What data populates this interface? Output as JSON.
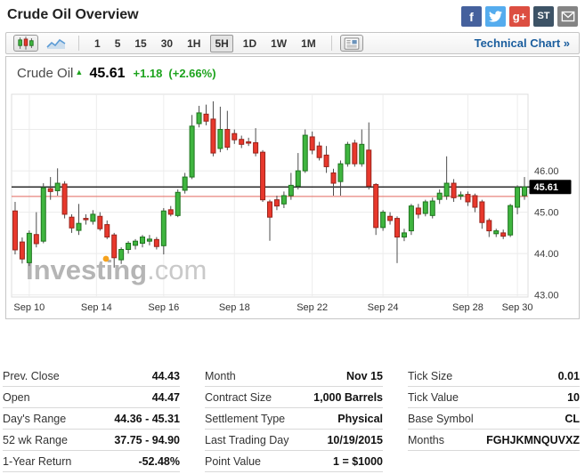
{
  "page_title": "Crude Oil Overview",
  "social_icons": [
    {
      "name": "facebook",
      "label": "f",
      "color": "#45619D"
    },
    {
      "name": "twitter",
      "label": "",
      "color": "#55ACEE"
    },
    {
      "name": "googleplus",
      "label": "g+",
      "color": "#DC4E41"
    },
    {
      "name": "stocktwits",
      "label": "ST",
      "color": "#3D5366"
    },
    {
      "name": "email",
      "label": "",
      "color": "#848484"
    }
  ],
  "toolbar": {
    "intervals": [
      "1",
      "5",
      "15",
      "30",
      "1H",
      "5H",
      "1D",
      "1W",
      "1M"
    ],
    "selected_interval": "5H",
    "technical_chart_label": "Technical Chart »"
  },
  "quote": {
    "name": "Crude Oil",
    "arrow": "▲",
    "last": "45.61",
    "change": "+1.18",
    "change_percent": "(+2.66%)"
  },
  "chart_data": {
    "type": "candlestick",
    "interval": "5H",
    "watermark_bold": "Investing",
    "watermark_light": ".com",
    "ylim": [
      42.95,
      47.85
    ],
    "grid_values": [
      47,
      46,
      45,
      44,
      43
    ],
    "y_ticks": [
      {
        "value": 46,
        "label": "46.00"
      },
      {
        "value": 45,
        "label": "45.00"
      },
      {
        "value": 44,
        "label": "44.00"
      },
      {
        "value": 43,
        "label": "43.00"
      }
    ],
    "x_ticks": [
      {
        "index": 2,
        "label": "Sep 10"
      },
      {
        "index": 11.5,
        "label": "Sep 14"
      },
      {
        "index": 21,
        "label": "Sep 16"
      },
      {
        "index": 31,
        "label": "Sep 18"
      },
      {
        "index": 42,
        "label": "Sep 22"
      },
      {
        "index": 52,
        "label": "Sep 24"
      },
      {
        "index": 64,
        "label": "Sep 28"
      },
      {
        "index": 71,
        "label": "Sep 30"
      }
    ],
    "last_price": 45.61,
    "last_price_label": "45.61",
    "prev_settlement_line": 45.38,
    "colors": {
      "up": "#3FB53F",
      "up_border": "#1E741E",
      "down": "#E8382C",
      "down_border": "#99231B",
      "wick": "#4D4D4D",
      "last_price_line": "#2B2B2B",
      "prev_line": "#E2685E",
      "quote_green": "#1DA31D"
    },
    "candles": [
      [
        45.03,
        45.25,
        43.98,
        44.09
      ],
      [
        44.28,
        44.39,
        43.76,
        43.87
      ],
      [
        43.78,
        44.56,
        43.7,
        44.49
      ],
      [
        44.46,
        45.0,
        44.15,
        44.24
      ],
      [
        44.3,
        45.7,
        44.25,
        45.59
      ],
      [
        45.57,
        45.85,
        45.3,
        45.5
      ],
      [
        45.52,
        46.06,
        45.4,
        45.7
      ],
      [
        45.68,
        45.75,
        44.85,
        44.95
      ],
      [
        44.88,
        44.95,
        44.5,
        44.62
      ],
      [
        44.56,
        45.2,
        44.45,
        44.73
      ],
      [
        44.85,
        44.95,
        44.7,
        44.83
      ],
      [
        44.78,
        45.05,
        44.7,
        44.95
      ],
      [
        44.9,
        45.0,
        44.55,
        44.6
      ],
      [
        44.7,
        44.8,
        44.35,
        44.4
      ],
      [
        44.45,
        44.5,
        43.66,
        43.9
      ],
      [
        43.85,
        44.15,
        43.75,
        44.1
      ],
      [
        44.1,
        44.3,
        44.0,
        44.25
      ],
      [
        44.2,
        44.35,
        44.1,
        44.3
      ],
      [
        44.25,
        44.45,
        44.15,
        44.4
      ],
      [
        44.3,
        44.45,
        44.2,
        44.35
      ],
      [
        44.34,
        44.4,
        44.1,
        44.17
      ],
      [
        44.19,
        45.1,
        43.98,
        45.03
      ],
      [
        45.06,
        45.15,
        44.9,
        44.95
      ],
      [
        44.92,
        45.55,
        44.88,
        45.48
      ],
      [
        45.53,
        45.95,
        45.45,
        45.85
      ],
      [
        45.85,
        47.35,
        45.8,
        47.08
      ],
      [
        47.14,
        47.57,
        47.05,
        47.4
      ],
      [
        47.37,
        47.6,
        47.1,
        47.2
      ],
      [
        47.25,
        47.68,
        46.35,
        46.43
      ],
      [
        46.54,
        47.55,
        46.45,
        47.0
      ],
      [
        47.0,
        47.45,
        46.5,
        46.57
      ],
      [
        46.9,
        47.0,
        46.65,
        46.75
      ],
      [
        46.76,
        46.85,
        46.55,
        46.64
      ],
      [
        46.7,
        46.8,
        46.6,
        46.68
      ],
      [
        46.68,
        47.03,
        46.35,
        46.43
      ],
      [
        46.45,
        46.5,
        45.25,
        45.3
      ],
      [
        45.25,
        45.3,
        44.31,
        44.88
      ],
      [
        45.3,
        45.4,
        45.05,
        45.15
      ],
      [
        45.2,
        45.5,
        45.1,
        45.4
      ],
      [
        45.4,
        45.95,
        45.3,
        45.65
      ],
      [
        45.63,
        46.43,
        45.55,
        46.0
      ],
      [
        46.0,
        47.0,
        45.95,
        46.86
      ],
      [
        46.82,
        46.95,
        46.4,
        46.5
      ],
      [
        46.6,
        46.7,
        46.25,
        46.32
      ],
      [
        46.38,
        46.6,
        45.95,
        46.1
      ],
      [
        45.95,
        46.05,
        45.4,
        45.7
      ],
      [
        45.74,
        46.25,
        45.4,
        46.17
      ],
      [
        46.17,
        46.7,
        46.1,
        46.64
      ],
      [
        46.67,
        46.75,
        46.1,
        46.17
      ],
      [
        46.17,
        47.0,
        46.1,
        46.64
      ],
      [
        46.5,
        47.17,
        45.55,
        45.63
      ],
      [
        45.67,
        45.7,
        44.45,
        44.63
      ],
      [
        44.63,
        45.05,
        44.55,
        45.0
      ],
      [
        44.9,
        45.0,
        44.7,
        44.8
      ],
      [
        44.85,
        44.9,
        43.77,
        44.4
      ],
      [
        44.4,
        44.6,
        44.3,
        44.5
      ],
      [
        44.55,
        45.2,
        44.45,
        45.15
      ],
      [
        45.1,
        45.2,
        44.85,
        44.95
      ],
      [
        44.97,
        45.3,
        44.9,
        45.25
      ],
      [
        44.92,
        45.35,
        44.85,
        45.27
      ],
      [
        45.31,
        45.55,
        45.2,
        45.46
      ],
      [
        45.39,
        46.35,
        45.3,
        45.7
      ],
      [
        45.7,
        45.8,
        45.25,
        45.35
      ],
      [
        45.4,
        45.5,
        45.3,
        45.42
      ],
      [
        45.43,
        45.5,
        45.15,
        45.25
      ],
      [
        45.4,
        45.45,
        45.0,
        45.12
      ],
      [
        45.25,
        45.3,
        44.6,
        44.75
      ],
      [
        44.8,
        44.85,
        44.4,
        44.55
      ],
      [
        44.48,
        44.6,
        44.4,
        44.55
      ],
      [
        44.5,
        44.58,
        44.35,
        44.42
      ],
      [
        44.45,
        45.2,
        44.4,
        45.16
      ],
      [
        45.12,
        45.65,
        44.95,
        45.6
      ],
      [
        45.4,
        45.85,
        45.3,
        45.61
      ]
    ]
  },
  "tables": [
    {
      "rows": [
        {
          "label": "Prev. Close",
          "value": "44.43"
        },
        {
          "label": "Open",
          "value": "44.47"
        },
        {
          "label": "Day's Range",
          "value": "44.36 - 45.31"
        },
        {
          "label": "52 wk Range",
          "value": "37.75 - 94.90"
        },
        {
          "label": "1-Year Return",
          "value": "-52.48%"
        }
      ]
    },
    {
      "rows": [
        {
          "label": "Month",
          "value": "Nov 15"
        },
        {
          "label": "Contract Size",
          "value": "1,000 Barrels"
        },
        {
          "label": "Settlement Type",
          "value": "Physical"
        },
        {
          "label": "Last Trading Day",
          "value": "10/19/2015"
        },
        {
          "label": "Point Value",
          "value": "1 = $1000"
        }
      ]
    },
    {
      "rows": [
        {
          "label": "Tick Size",
          "value": "0.01"
        },
        {
          "label": "Tick Value",
          "value": "10"
        },
        {
          "label": "Base Symbol",
          "value": "CL"
        },
        {
          "label": "Months",
          "value": "FGHJKMNQUVXZ"
        }
      ]
    }
  ]
}
